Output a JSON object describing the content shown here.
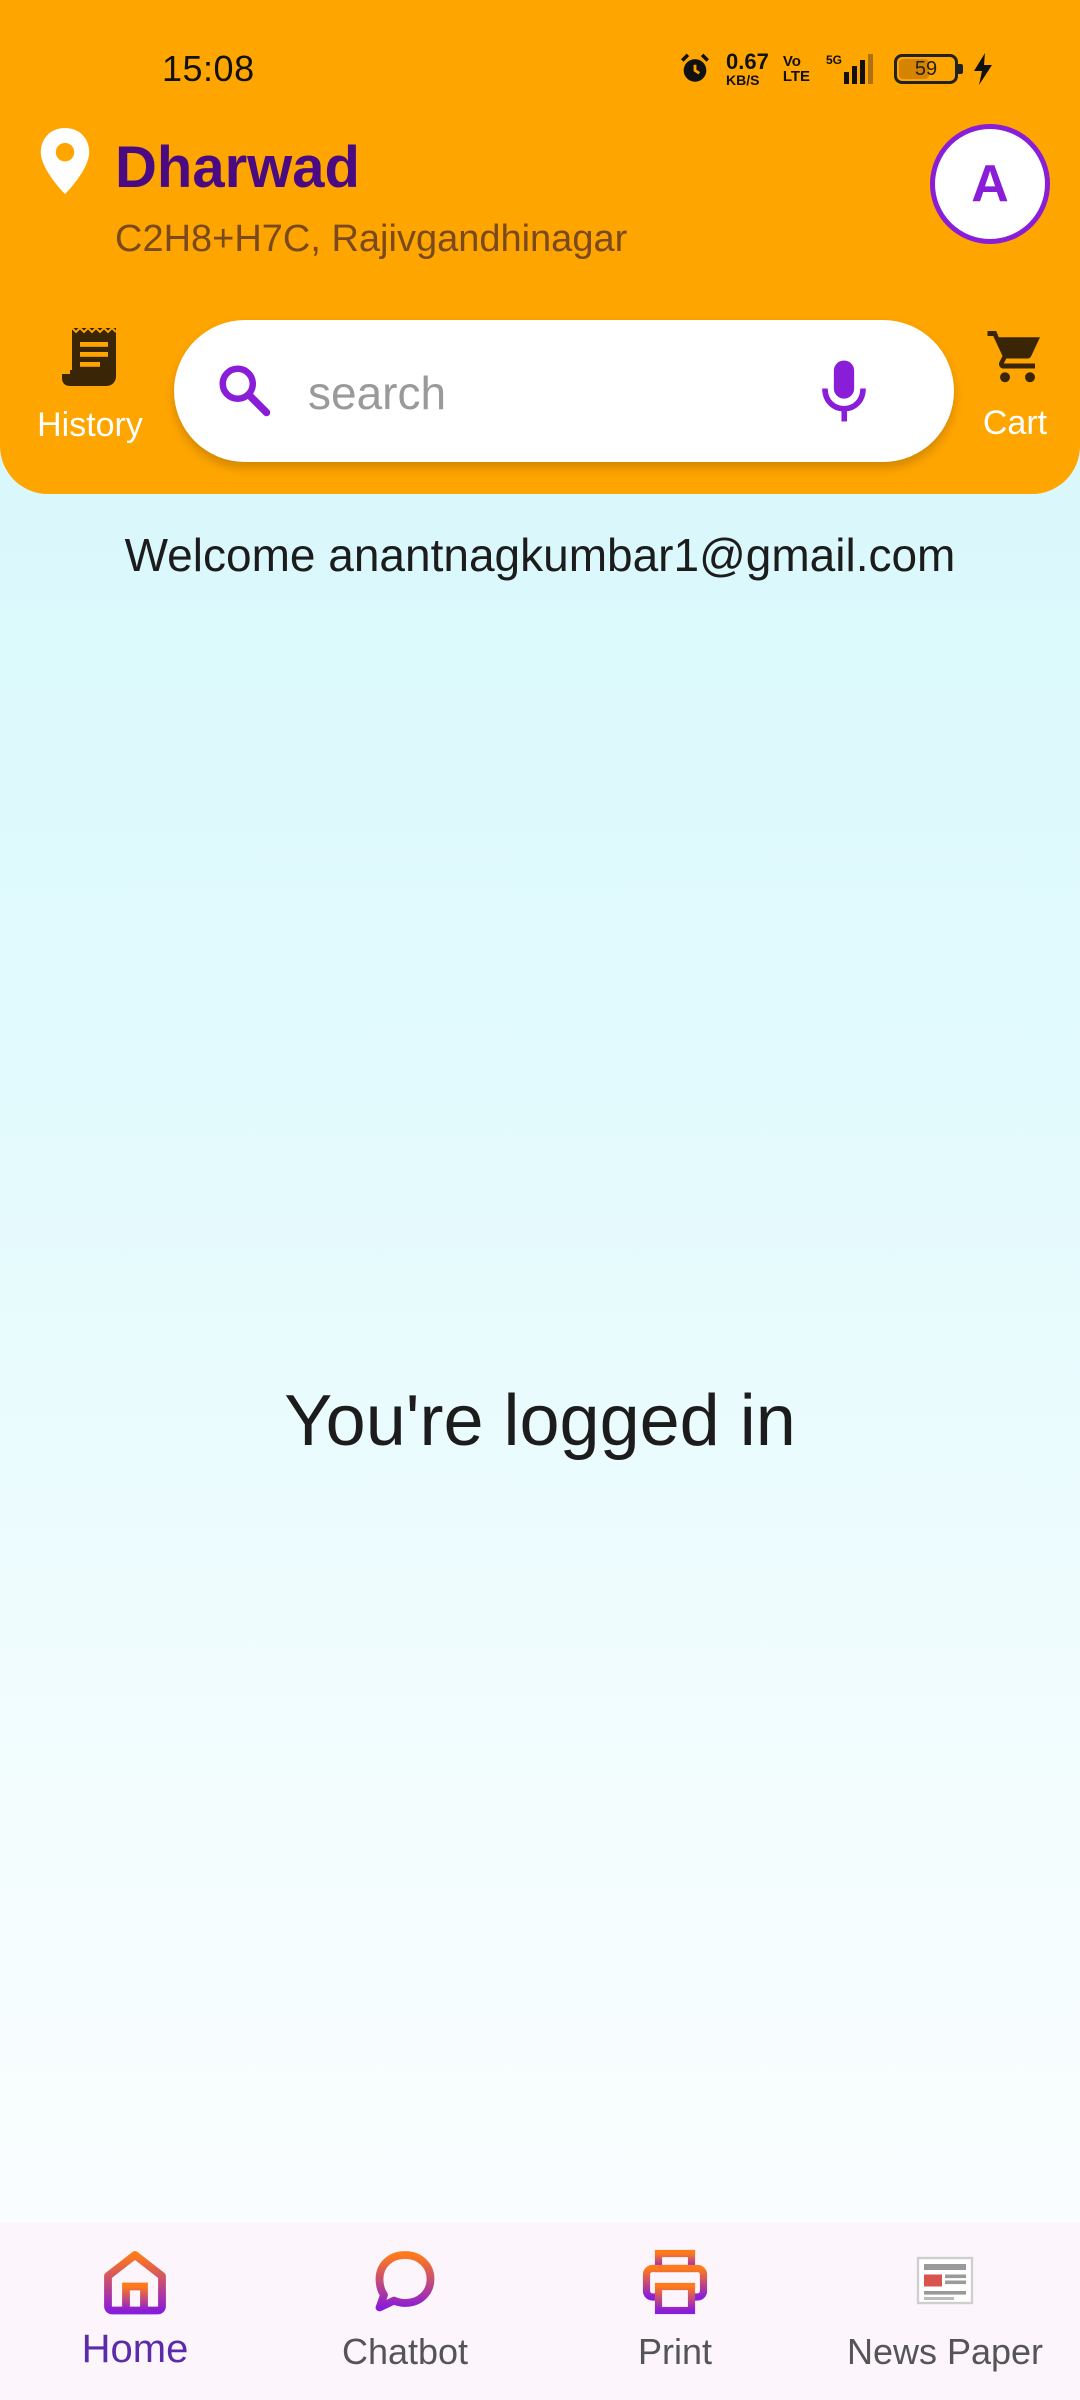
{
  "status_bar": {
    "time": "15:08",
    "net_speed_value": "0.67",
    "net_speed_unit": "KB/S",
    "volte_top": "Vo",
    "volte_bottom": "LTE",
    "network": "5G",
    "battery_level": "59",
    "battery_fraction": 0.59
  },
  "header": {
    "city": "Dharwad",
    "address": "C2H8+H7C, Rajivgandhinagar",
    "avatar_letter": "A",
    "history_label": "History",
    "cart_label": "Cart"
  },
  "search": {
    "placeholder": "search"
  },
  "main": {
    "welcome": "Welcome anantnagkumbar1@gmail.com",
    "status_message": "You're logged in"
  },
  "bottom_nav": {
    "items": [
      {
        "label": "Home",
        "icon": "home-icon",
        "active": true
      },
      {
        "label": "Chatbot",
        "icon": "chat-bubble-icon",
        "active": false
      },
      {
        "label": "Print",
        "icon": "printer-icon",
        "active": false
      },
      {
        "label": "News Paper",
        "icon": "newspaper-icon",
        "active": false
      }
    ]
  },
  "colors": {
    "header_bg": "#ffa500",
    "brand_purple": "#8a1dd8",
    "city_text": "#4a0a82"
  }
}
